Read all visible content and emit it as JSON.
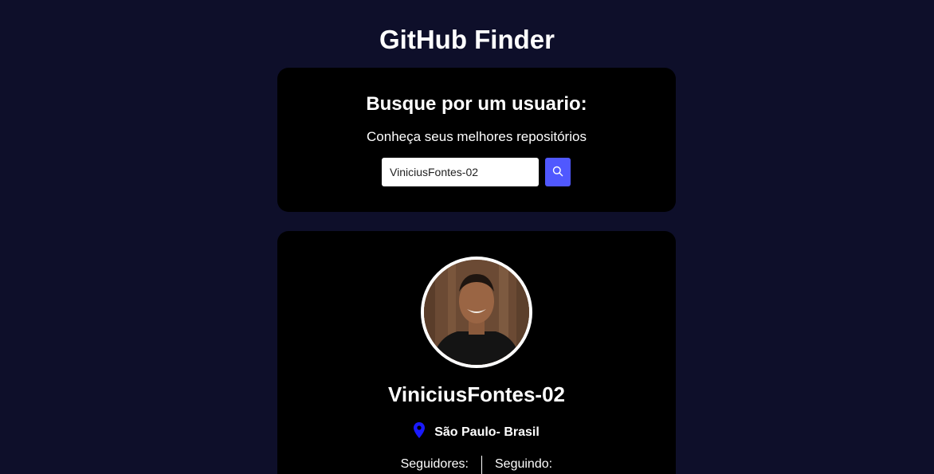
{
  "app": {
    "title": "GitHub Finder"
  },
  "search": {
    "heading": "Busque por um usuario:",
    "subtitle": "Conheça seus melhores repositórios",
    "input_value": "ViniciusFontes-02",
    "button_icon": "search-icon"
  },
  "profile": {
    "avatar_alt": "ViniciusFontes-02",
    "username": "ViniciusFontes-02",
    "location": "São Paulo- Brasil",
    "location_icon": "location-pin-icon",
    "followers_label": "Seguidores:",
    "following_label": "Seguindo:"
  },
  "colors": {
    "background": "#0e0f2a",
    "card": "#000000",
    "accent": "#5058ff",
    "pin": "#1a1aff"
  }
}
